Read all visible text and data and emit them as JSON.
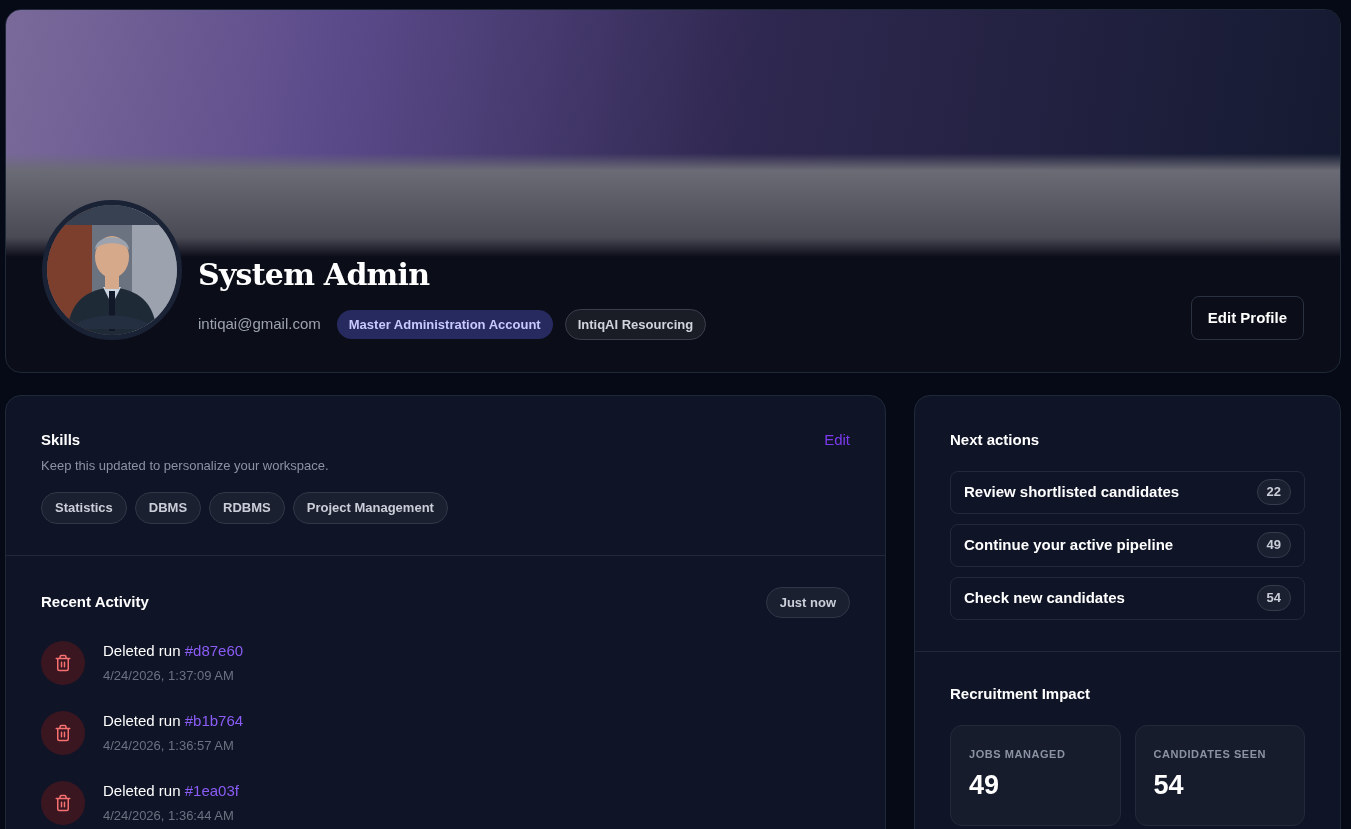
{
  "profile": {
    "name": "System Admin",
    "email": "intiqai@gmail.com",
    "badges": [
      {
        "label": "Master Administration Account",
        "kind": "primary"
      },
      {
        "label": "IntiqAI Resourcing",
        "kind": "neutral"
      }
    ],
    "edit_button": "Edit Profile"
  },
  "skills": {
    "title": "Skills",
    "edit": "Edit",
    "subtitle": "Keep this updated to personalize your workspace.",
    "items": [
      "Statistics",
      "DBMS",
      "RDBMS",
      "Project Management"
    ]
  },
  "activity": {
    "title": "Recent Activity",
    "badge": "Just now",
    "items": [
      {
        "text": "Deleted run",
        "ref": "#d87e60",
        "time": "4/24/2026, 1:37:09 AM"
      },
      {
        "text": "Deleted run",
        "ref": "#b1b764",
        "time": "4/24/2026, 1:36:57 AM"
      },
      {
        "text": "Deleted run",
        "ref": "#1ea03f",
        "time": "4/24/2026, 1:36:44 AM"
      }
    ]
  },
  "next_actions": {
    "title": "Next actions",
    "items": [
      {
        "label": "Review shortlisted candidates",
        "count": "22"
      },
      {
        "label": "Continue your active pipeline",
        "count": "49"
      },
      {
        "label": "Check new candidates",
        "count": "54"
      }
    ]
  },
  "impact": {
    "title": "Recruitment Impact",
    "stats": [
      {
        "label": "JOBS MANAGED",
        "value": "49"
      },
      {
        "label": "CANDIDATES SEEN",
        "value": "54"
      }
    ]
  }
}
